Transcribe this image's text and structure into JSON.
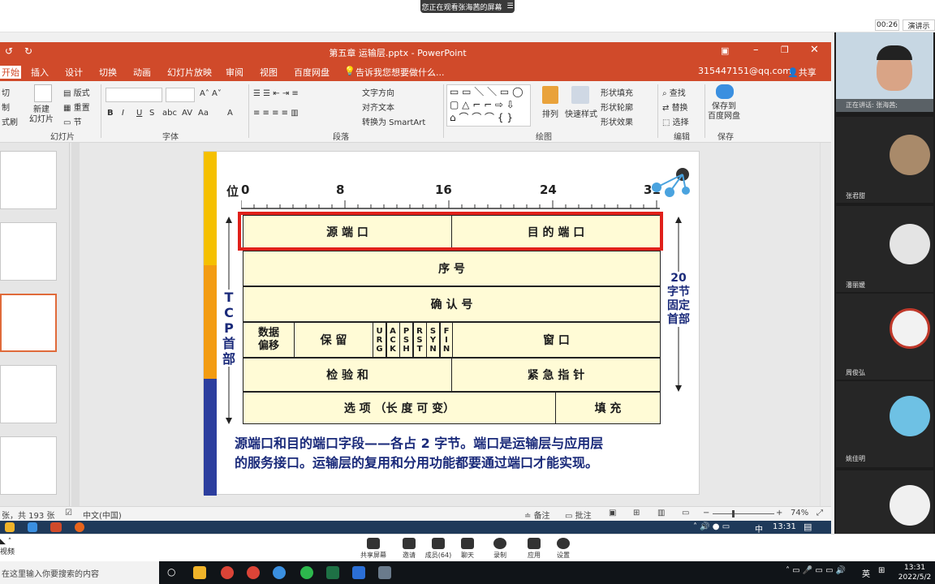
{
  "share_bar": {
    "banner": "您正在观看张海茜的屏幕",
    "timer": "00:26",
    "demo_button": "演讲示"
  },
  "ppt": {
    "title": "第五章 运输层.pptx - PowerPoint",
    "user_email": "315447151@qq.com",
    "share": "共享",
    "tabs": [
      "开始",
      "插入",
      "设计",
      "切换",
      "动画",
      "幻灯片放映",
      "审阅",
      "视图",
      "百度网盘"
    ],
    "tellme": "告诉我您想要做什么...",
    "ribbon": {
      "new_slide": "新建\n幻灯片",
      "layout": "版式",
      "reset": "重置",
      "section": "节",
      "group_slides": "幻灯片",
      "group_font": "字体",
      "group_paragraph": "段落",
      "group_drawing": "绘图",
      "group_edit": "编辑",
      "group_save": "保存",
      "text_direction": "文字方向",
      "align_text": "对齐文本",
      "convert_smartart": "转换为 SmartArt",
      "arrange": "排列",
      "quick_styles": "快速样式",
      "shape_fill": "形状填充",
      "shape_outline": "形状轮廓",
      "shape_effects": "形状效果",
      "find": "查找",
      "replace": "替换",
      "select": "选择",
      "save_to": "保存到\n百度网盘",
      "cut": "切",
      "copy": "制",
      "format": "式刷"
    },
    "status": {
      "slides": "张，共 193 张",
      "lang": "中文(中国)",
      "notes": "备注",
      "comments": "批注",
      "zoom": "74%"
    },
    "slide": {
      "bit_label": "位",
      "bits": [
        "0",
        "8",
        "16",
        "24",
        "31"
      ],
      "src_port": "源 端 口",
      "dst_port": "目 的 端 口",
      "seq": "序 号",
      "ack": "确 认 号",
      "data_offset": "数据\n偏移",
      "reserved": "保 留",
      "flags": [
        "URG",
        "ACK",
        "PSH",
        "RST",
        "SYN",
        "FIN"
      ],
      "window": "窗 口",
      "checksum": "检 验 和",
      "urgent": "紧 急 指 针",
      "options": "选 项 （长 度 可 变）",
      "padding": "填 充",
      "tcp_header": "TCP首部",
      "fixed_part": "20\n字节\n固定\n首部",
      "note_line1": "源端口和目的端口字段——各占 2 字节。端口是运输层与应用层",
      "note_line2": "的服务接口。运输层的复用和分用功能都要通过端口才能实现。"
    }
  },
  "video_panel": {
    "speaking": "正在讲话: 张海茜;",
    "participants": [
      "张君甜",
      "潘丽媛",
      "周俊弘",
      "姚佳明"
    ]
  },
  "meeting_bar": {
    "items": [
      "共享屏幕",
      "邀请",
      "成员(64)",
      "聊天",
      "录制",
      "应用",
      "设置"
    ]
  },
  "win_taskbar": {
    "search": "在这里输入你要搜索的内容",
    "left_label": "视频",
    "time": "13:31",
    "date": "2022/5/2",
    "ime": "英",
    "tray_time": "13:31",
    "tray_ime": "中"
  },
  "colors": {
    "ppt_red": "#d04a2a",
    "highlight": "#e0201a",
    "cell_bg": "#fffbd6",
    "note_blue": "#1a2a7a"
  }
}
